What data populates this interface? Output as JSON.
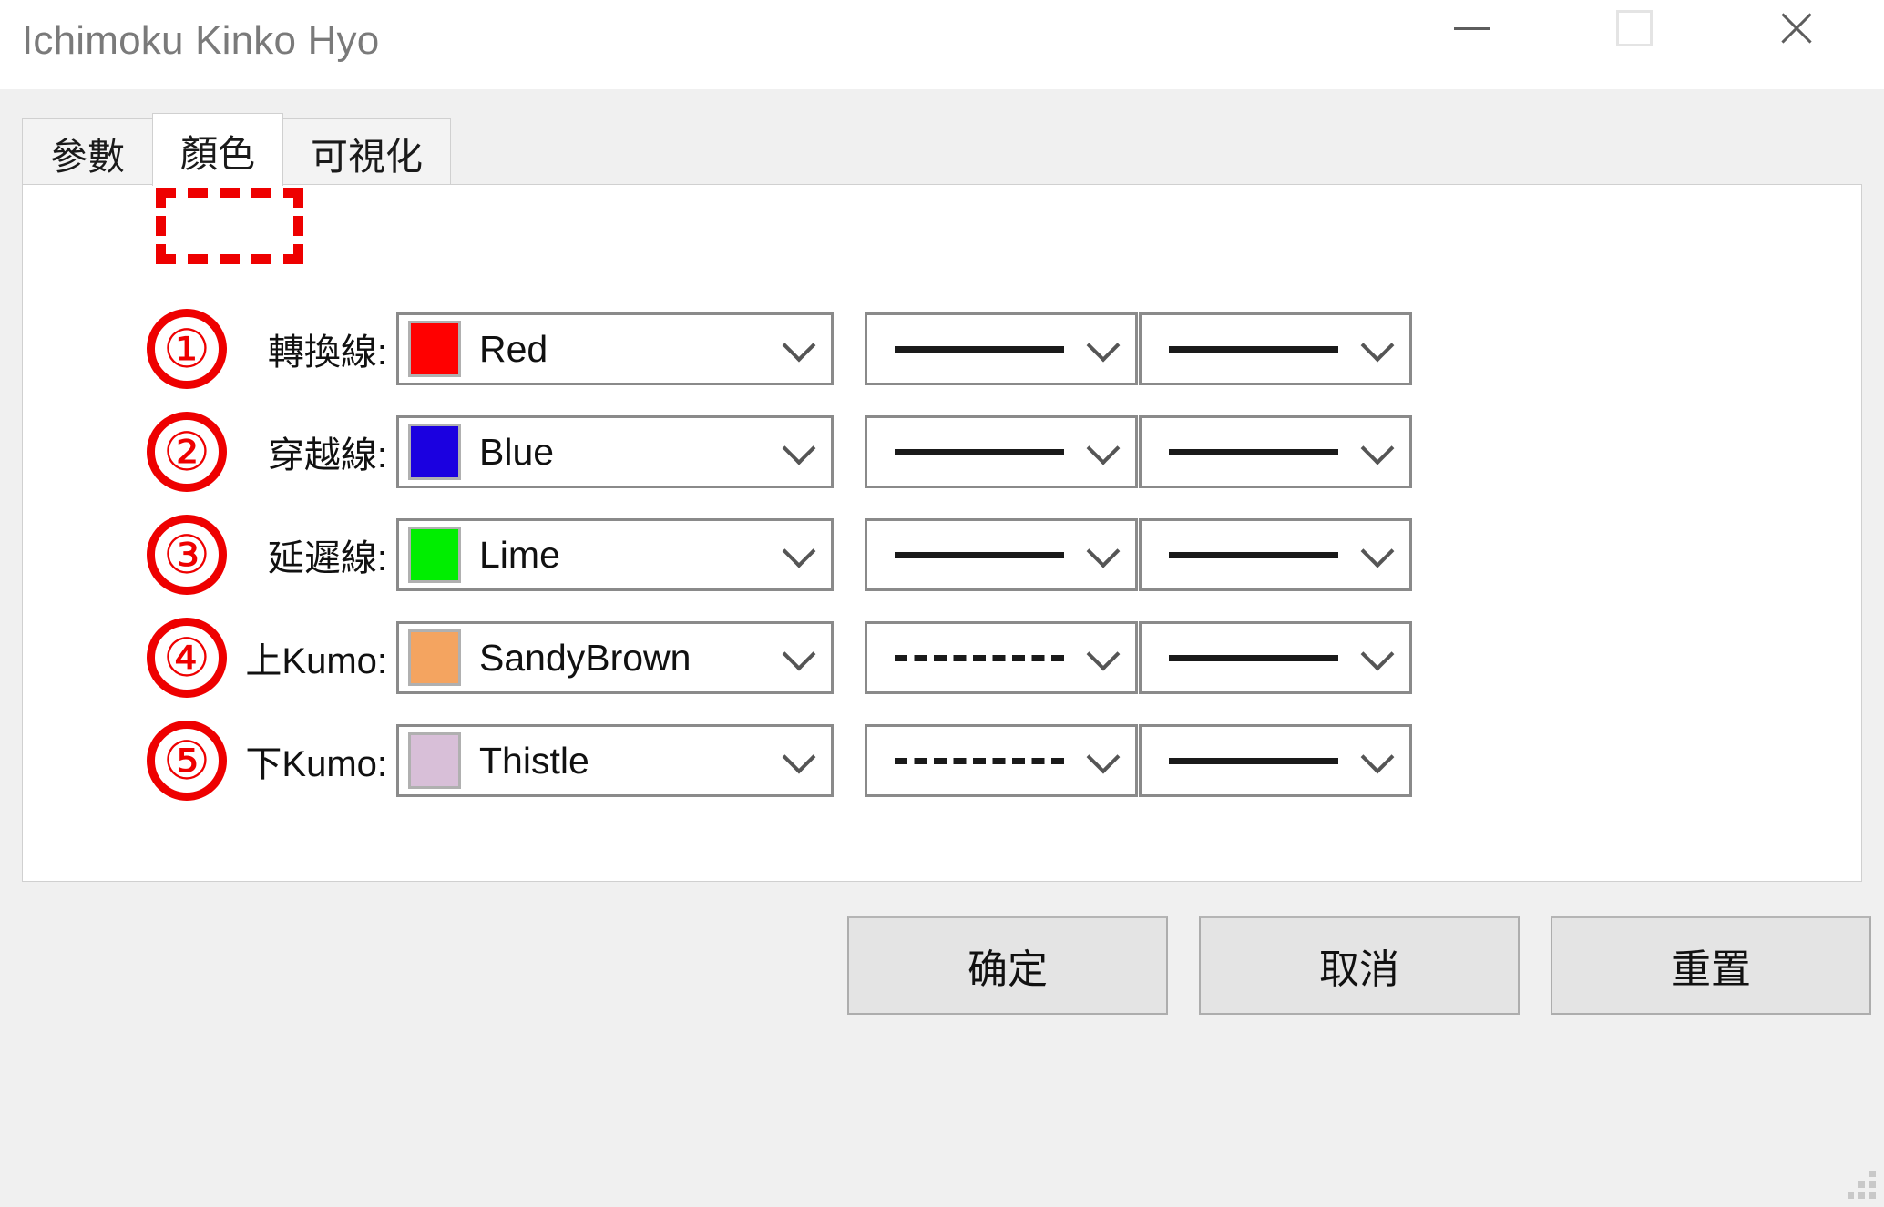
{
  "window": {
    "title": "Ichimoku Kinko Hyo",
    "controls": {
      "minimize": "minimize-icon",
      "maximize": "maximize-icon",
      "close": "close-icon"
    }
  },
  "tabs": [
    {
      "label": "參數",
      "active": false
    },
    {
      "label": "顏色",
      "active": true
    },
    {
      "label": "可視化",
      "active": false
    }
  ],
  "annotation": {
    "highlight_color": "#EE0000",
    "highlight_target": "顏色"
  },
  "rows": [
    {
      "badge": "①",
      "label": "轉換線:",
      "color_name": "Red",
      "color_hex": "#FF0000",
      "line_style": "solid",
      "line_width": "solid"
    },
    {
      "badge": "②",
      "label": "穿越線:",
      "color_name": "Blue",
      "color_hex": "#1B00E0",
      "line_style": "solid",
      "line_width": "solid"
    },
    {
      "badge": "③",
      "label": "延遲線:",
      "color_name": "Lime",
      "color_hex": "#00EE00",
      "line_style": "solid",
      "line_width": "solid"
    },
    {
      "badge": "④",
      "label": "上Kumo:",
      "color_name": "SandyBrown",
      "color_hex": "#F4A460",
      "line_style": "dashed",
      "line_width": "solid"
    },
    {
      "badge": "⑤",
      "label": "下Kumo:",
      "color_name": "Thistle",
      "color_hex": "#D8BFD8",
      "line_style": "dashed",
      "line_width": "solid"
    }
  ],
  "footer": {
    "ok": "确定",
    "cancel": "取消",
    "reset": "重置"
  }
}
